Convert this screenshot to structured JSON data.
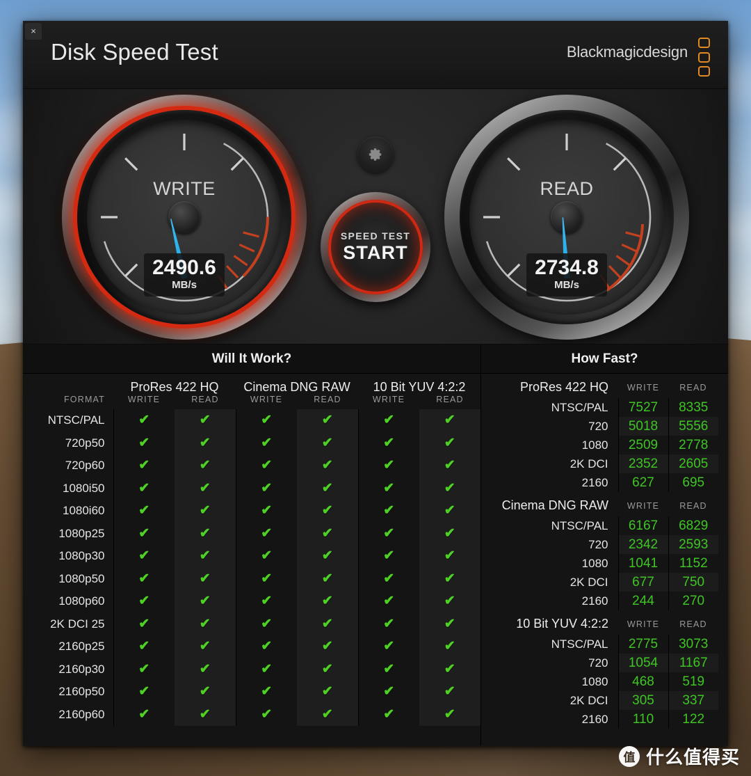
{
  "window": {
    "title": "Disk Speed Test",
    "brand": "Blackmagicdesign",
    "close_label": "×"
  },
  "gauges": {
    "write": {
      "label": "WRITE",
      "value": "2490.6",
      "unit": "MB/s",
      "needle_angle_deg": -13,
      "glow": true,
      "glow_color": "#d42a12"
    },
    "read": {
      "label": "READ",
      "value": "2734.8",
      "unit": "MB/s",
      "needle_angle_deg": -4,
      "glow": false
    }
  },
  "controls": {
    "gear_icon": "gear-icon",
    "start_line1": "SPEED TEST",
    "start_line2": "START"
  },
  "will_it_work": {
    "title": "Will It Work?",
    "format_header": "FORMAT",
    "codecs": [
      "ProRes 422 HQ",
      "Cinema DNG RAW",
      "10 Bit YUV 4:2:2"
    ],
    "sub_headers": [
      "WRITE",
      "READ"
    ],
    "check_glyph": "✔",
    "check_color": "#4fd024",
    "rows": [
      {
        "format": "NTSC/PAL",
        "cells": [
          true,
          true,
          true,
          true,
          true,
          true
        ]
      },
      {
        "format": "720p50",
        "cells": [
          true,
          true,
          true,
          true,
          true,
          true
        ]
      },
      {
        "format": "720p60",
        "cells": [
          true,
          true,
          true,
          true,
          true,
          true
        ]
      },
      {
        "format": "1080i50",
        "cells": [
          true,
          true,
          true,
          true,
          true,
          true
        ]
      },
      {
        "format": "1080i60",
        "cells": [
          true,
          true,
          true,
          true,
          true,
          true
        ]
      },
      {
        "format": "1080p25",
        "cells": [
          true,
          true,
          true,
          true,
          true,
          true
        ]
      },
      {
        "format": "1080p30",
        "cells": [
          true,
          true,
          true,
          true,
          true,
          true
        ]
      },
      {
        "format": "1080p50",
        "cells": [
          true,
          true,
          true,
          true,
          true,
          true
        ]
      },
      {
        "format": "1080p60",
        "cells": [
          true,
          true,
          true,
          true,
          true,
          true
        ]
      },
      {
        "format": "2K DCI 25",
        "cells": [
          true,
          true,
          true,
          true,
          true,
          true
        ]
      },
      {
        "format": "2160p25",
        "cells": [
          true,
          true,
          true,
          true,
          true,
          true
        ]
      },
      {
        "format": "2160p30",
        "cells": [
          true,
          true,
          true,
          true,
          true,
          true
        ]
      },
      {
        "format": "2160p50",
        "cells": [
          true,
          true,
          true,
          true,
          true,
          true
        ]
      },
      {
        "format": "2160p60",
        "cells": [
          true,
          true,
          true,
          true,
          true,
          true
        ]
      }
    ]
  },
  "how_fast": {
    "title": "How Fast?",
    "col_write": "WRITE",
    "col_read": "READ",
    "groups": [
      {
        "name": "ProRes 422 HQ",
        "rows": [
          {
            "res": "NTSC/PAL",
            "write": "7527",
            "read": "8335"
          },
          {
            "res": "720",
            "write": "5018",
            "read": "5556"
          },
          {
            "res": "1080",
            "write": "2509",
            "read": "2778"
          },
          {
            "res": "2K DCI",
            "write": "2352",
            "read": "2605"
          },
          {
            "res": "2160",
            "write": "627",
            "read": "695"
          }
        ]
      },
      {
        "name": "Cinema DNG RAW",
        "rows": [
          {
            "res": "NTSC/PAL",
            "write": "6167",
            "read": "6829"
          },
          {
            "res": "720",
            "write": "2342",
            "read": "2593"
          },
          {
            "res": "1080",
            "write": "1041",
            "read": "1152"
          },
          {
            "res": "2K DCI",
            "write": "677",
            "read": "750"
          },
          {
            "res": "2160",
            "write": "244",
            "read": "270"
          }
        ]
      },
      {
        "name": "10 Bit YUV 4:2:2",
        "rows": [
          {
            "res": "NTSC/PAL",
            "write": "2775",
            "read": "3073"
          },
          {
            "res": "720",
            "write": "1054",
            "read": "1167"
          },
          {
            "res": "1080",
            "write": "468",
            "read": "519"
          },
          {
            "res": "2K DCI",
            "write": "305",
            "read": "337"
          },
          {
            "res": "2160",
            "write": "110",
            "read": "122"
          }
        ]
      }
    ]
  },
  "watermark": {
    "logo_char": "值",
    "text": "什么值得买"
  }
}
